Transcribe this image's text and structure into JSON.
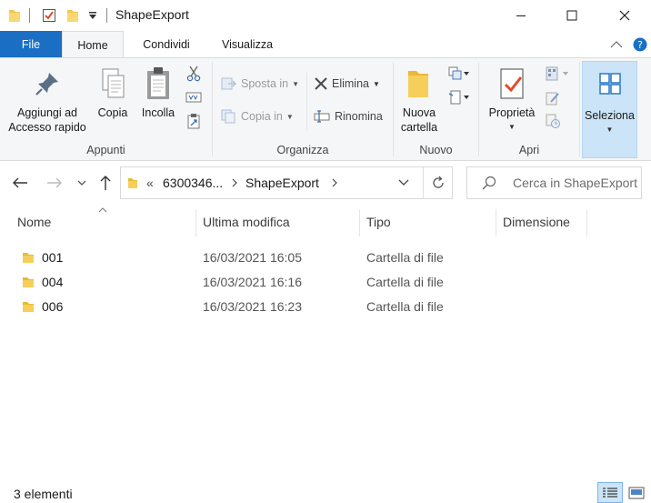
{
  "window": {
    "title": "ShapeExport"
  },
  "tabs": [
    {
      "label": "File"
    },
    {
      "label": "Home"
    },
    {
      "label": "Condividi"
    },
    {
      "label": "Visualizza"
    }
  ],
  "ribbon": {
    "appunti": {
      "group_label": "Appunti",
      "pin_label_1": "Aggiungi ad",
      "pin_label_2": "Accesso rapido",
      "copy_label": "Copia",
      "paste_label": "Incolla"
    },
    "organizza": {
      "group_label": "Organizza",
      "move_label": "Sposta in",
      "copy_to_label": "Copia in",
      "delete_label": "Elimina",
      "rename_label": "Rinomina"
    },
    "nuovo": {
      "group_label": "Nuovo",
      "new_folder_1": "Nuova",
      "new_folder_2": "cartella"
    },
    "apri": {
      "group_label": "Apri",
      "properties_label": "Proprietà"
    },
    "seleziona": {
      "select_label": "Seleziona"
    }
  },
  "address": {
    "overflow": "«",
    "segment_1": "6300346...",
    "segment_2": "ShapeExport"
  },
  "search": {
    "placeholder": "Cerca in ShapeExport"
  },
  "columns": {
    "name": "Nome",
    "modified": "Ultima modifica",
    "type": "Tipo",
    "size": "Dimensione"
  },
  "files": [
    {
      "name": "001",
      "modified": "16/03/2021 16:05",
      "type": "Cartella di file"
    },
    {
      "name": "004",
      "modified": "16/03/2021 16:16",
      "type": "Cartella di file"
    },
    {
      "name": "006",
      "modified": "16/03/2021 16:23",
      "type": "Cartella di file"
    }
  ],
  "status": {
    "count": "3 elementi"
  },
  "colors": {
    "accent": "#1a6fc4",
    "folder": "#f4c64a",
    "selected": "#cce4f7"
  }
}
